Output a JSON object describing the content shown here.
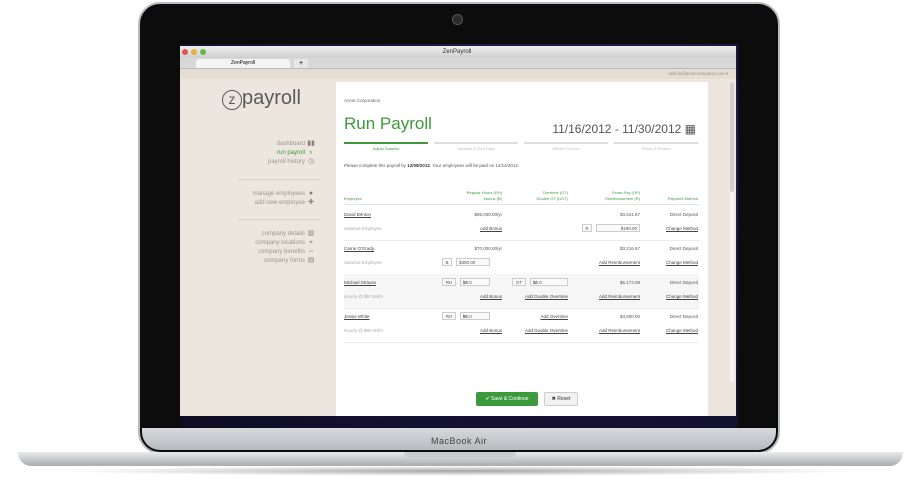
{
  "laptop": {
    "brand": "MacBook Air"
  },
  "window": {
    "title": "ZenPayroll",
    "tab_label": "ZenPayroll",
    "new_tab": "+",
    "user_email": "admin@acmecompany.com ▾"
  },
  "sidebar": {
    "logo": "payroll",
    "logo_mark": "zen",
    "nav_primary": [
      {
        "label": "dashboard",
        "icon": "bar-chart-icon",
        "glyph": "▮▮"
      },
      {
        "label": "run payroll",
        "icon": "money-bag-icon",
        "glyph": "♁"
      },
      {
        "label": "payroll history",
        "icon": "clock-icon",
        "glyph": "◷"
      }
    ],
    "nav_people": [
      {
        "label": "manage employees",
        "icon": "person-icon",
        "glyph": "●"
      },
      {
        "label": "add new employee",
        "icon": "plus-icon",
        "glyph": "✚"
      }
    ],
    "nav_company": [
      {
        "label": "company details",
        "icon": "building-icon",
        "glyph": "▥"
      },
      {
        "label": "company locations",
        "icon": "map-pin-icon",
        "glyph": "⌖"
      },
      {
        "label": "company benefits",
        "icon": "arrows-icon",
        "glyph": "⇔"
      },
      {
        "label": "company forms",
        "icon": "document-icon",
        "glyph": "▤"
      }
    ]
  },
  "main": {
    "company": "Acme Corporation",
    "title": "Run Payroll",
    "date_range": "11/16/2012 - 11/30/2012",
    "steps": [
      "Adjust Salaries",
      "Vacation & Sick Days",
      "Written Checks",
      "Finish & Review"
    ],
    "notice_prefix": "Please complete this payroll by",
    "notice_date": "12/09/2012",
    "notice_suffix": ". Your employees will be paid on 12/14/2012.",
    "columns": {
      "employee": "Employee",
      "regular_line1": "Regular Hours (RH)",
      "regular_line2": "Bonus (B)",
      "overtime_line1": "Overtime (OT)",
      "overtime_line2": "Double OT (DOT)",
      "gross_line1": "Gross Pay (GP)",
      "gross_line2": "Reimbursement (R)",
      "method": "Payment Method"
    },
    "rows": [
      {
        "name": "David Brinton",
        "type": "Salaried Employee",
        "regular": "$85,000.00/yr",
        "bonus_link": "Add Bonus",
        "overtime": "",
        "double_ot": "",
        "gross": "$3,541.67",
        "reimb_tag": "R",
        "reimb_value": "$190.00",
        "method": "Direct Deposit",
        "change": "Change Method"
      },
      {
        "name": "Carrie O'Grady",
        "type": "Salaried Employee",
        "regular": "$70,000.00/yr",
        "bonus_tag": "B",
        "bonus_value": "$300.00",
        "overtime": "",
        "double_ot": "",
        "gross": "$3,216.67",
        "reimb_link": "Add Reimbursement",
        "method": "Direct Deposit",
        "change": "Change Method"
      },
      {
        "name": "Michael Strauss",
        "type": "Hourly @ $57.69/hr",
        "rh_tag": "RH",
        "rh_value": "40.0",
        "rh_unit": "hr",
        "bonus_link": "Add Bonus",
        "ot_tag": "OT",
        "ot_value": "10.0",
        "ot_unit": "hr",
        "dot_link": "Add Double Overtime",
        "gross": "$5,173.08",
        "reimb_link": "Add Reimbursement",
        "method": "Direct Deposit",
        "change": "Change Method"
      },
      {
        "name": "Jessie White",
        "type": "Hourly @ $80.00/hr",
        "rh_tag": "RH",
        "rh_value": "60.0",
        "rh_unit": "hr",
        "bonus_link": "Add Bonus",
        "ot_link": "Add Overtime",
        "dot_link": "Add Double Overtime",
        "gross": "$4,800.00",
        "reimb_link": "Add Reimbursement",
        "method": "Direct Deposit",
        "change": "Change Method"
      }
    ],
    "save_label": "Save & Continue",
    "reset_label": "Reset"
  }
}
